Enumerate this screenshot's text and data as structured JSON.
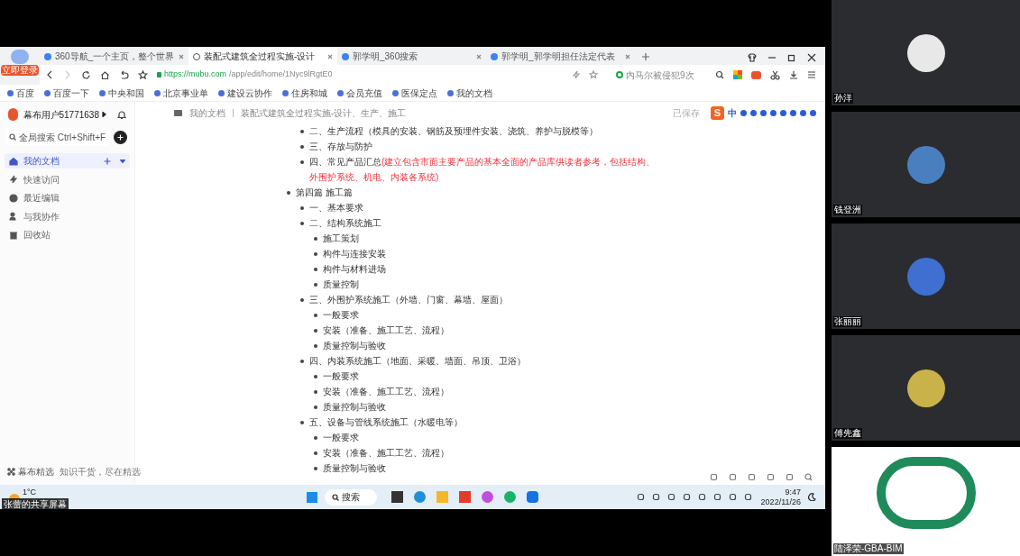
{
  "screen_share_label": "张蕾的共享屏幕",
  "browser": {
    "login_badge": "立即登录",
    "tabs": [
      {
        "label": "360导航_一个主页，整个世界",
        "selected": false
      },
      {
        "label": "装配式建筑全过程实施-设计",
        "selected": true
      },
      {
        "label": "郭学明_360搜索",
        "selected": false
      },
      {
        "label": "郭学明_郭学明担任法定代表",
        "selected": false
      }
    ],
    "url_host": "https://mubu.com",
    "url_path": "/app/edit/home/1Nyc9lRgtE0",
    "search_hint": "内马尔被侵犯9次",
    "bookmarks": [
      "百度",
      "百度一下",
      "中央和国",
      "北京事业单",
      "建设云协作",
      "住房和城",
      "会员充值",
      "医保定点",
      "我的文档"
    ]
  },
  "app": {
    "user": "幕布用户51771638",
    "search_placeholder": "全局搜索 Ctrl+Shift+F",
    "nav": [
      {
        "label": "我的文档",
        "selected": true
      },
      {
        "label": "快速访问",
        "selected": false
      },
      {
        "label": "最近编辑",
        "selected": false
      },
      {
        "label": "与我协作",
        "selected": false
      },
      {
        "label": "回收站",
        "selected": false
      }
    ],
    "footer_title": "幕布精选",
    "footer_text": "知识干货，尽在精选",
    "breadcrumb": [
      "我的文档",
      "装配式建筑全过程实施-设计、生产、施工"
    ],
    "save_status": "已保存",
    "ime_logo": "S",
    "ime_mode": "中",
    "outline": [
      {
        "children": [
          {
            "text": "二、生产流程（模具的安装、钢筋及预埋件安装、浇筑、养护与脱模等）"
          },
          {
            "text": "三、存放与防护"
          },
          {
            "text": "四、常见产品汇总",
            "note": "(建立包含市面主要产品的基本全面的产品库供读者参考，包括结构、外围护系统、机电、内装各系统)"
          }
        ]
      },
      {
        "text": "第四篇 施工篇",
        "children": [
          {
            "text": "一、基本要求"
          },
          {
            "text": "二、结构系统施工",
            "children": [
              {
                "text": "施工策划"
              },
              {
                "text": "构件与连接安装"
              },
              {
                "text": "构件与材料进场"
              },
              {
                "text": "质量控制"
              }
            ]
          },
          {
            "text": "三、外围护系统施工（外墙、门窗、幕墙、屋面）",
            "children": [
              {
                "text": "一般要求"
              },
              {
                "text": "安装（准备、施工工艺、流程）"
              },
              {
                "text": "质量控制与验收"
              }
            ]
          },
          {
            "text": "四、内装系统施工（地面、采暖、墙面、吊顶、卫浴）",
            "children": [
              {
                "text": "一般要求"
              },
              {
                "text": "安装（准备、施工工艺、流程）"
              },
              {
                "text": "质量控制与验收"
              }
            ]
          },
          {
            "text": "五、设备与管线系统施工（水暖电等）",
            "children": [
              {
                "text": "一般要求"
              },
              {
                "text": "安装（准备、施工工艺、流程）"
              },
              {
                "text": "质量控制与验收"
              }
            ]
          }
        ]
      }
    ]
  },
  "taskbar": {
    "temperature": "1°C",
    "search": "搜索",
    "time": "9:47",
    "date": "2022/11/26"
  },
  "participants": [
    {
      "name": "孙洋",
      "kind": "avatar",
      "color": "#e8e8e8"
    },
    {
      "name": "钱登洲",
      "kind": "avatar",
      "color": "#4a7fbf"
    },
    {
      "name": "张丽丽",
      "kind": "avatar",
      "color": "#3f6fd0"
    },
    {
      "name": "傅先鑫",
      "kind": "avatar",
      "color": "#c9b24a"
    },
    {
      "name": "陆泽荣-GBA-BIM",
      "kind": "video"
    }
  ]
}
